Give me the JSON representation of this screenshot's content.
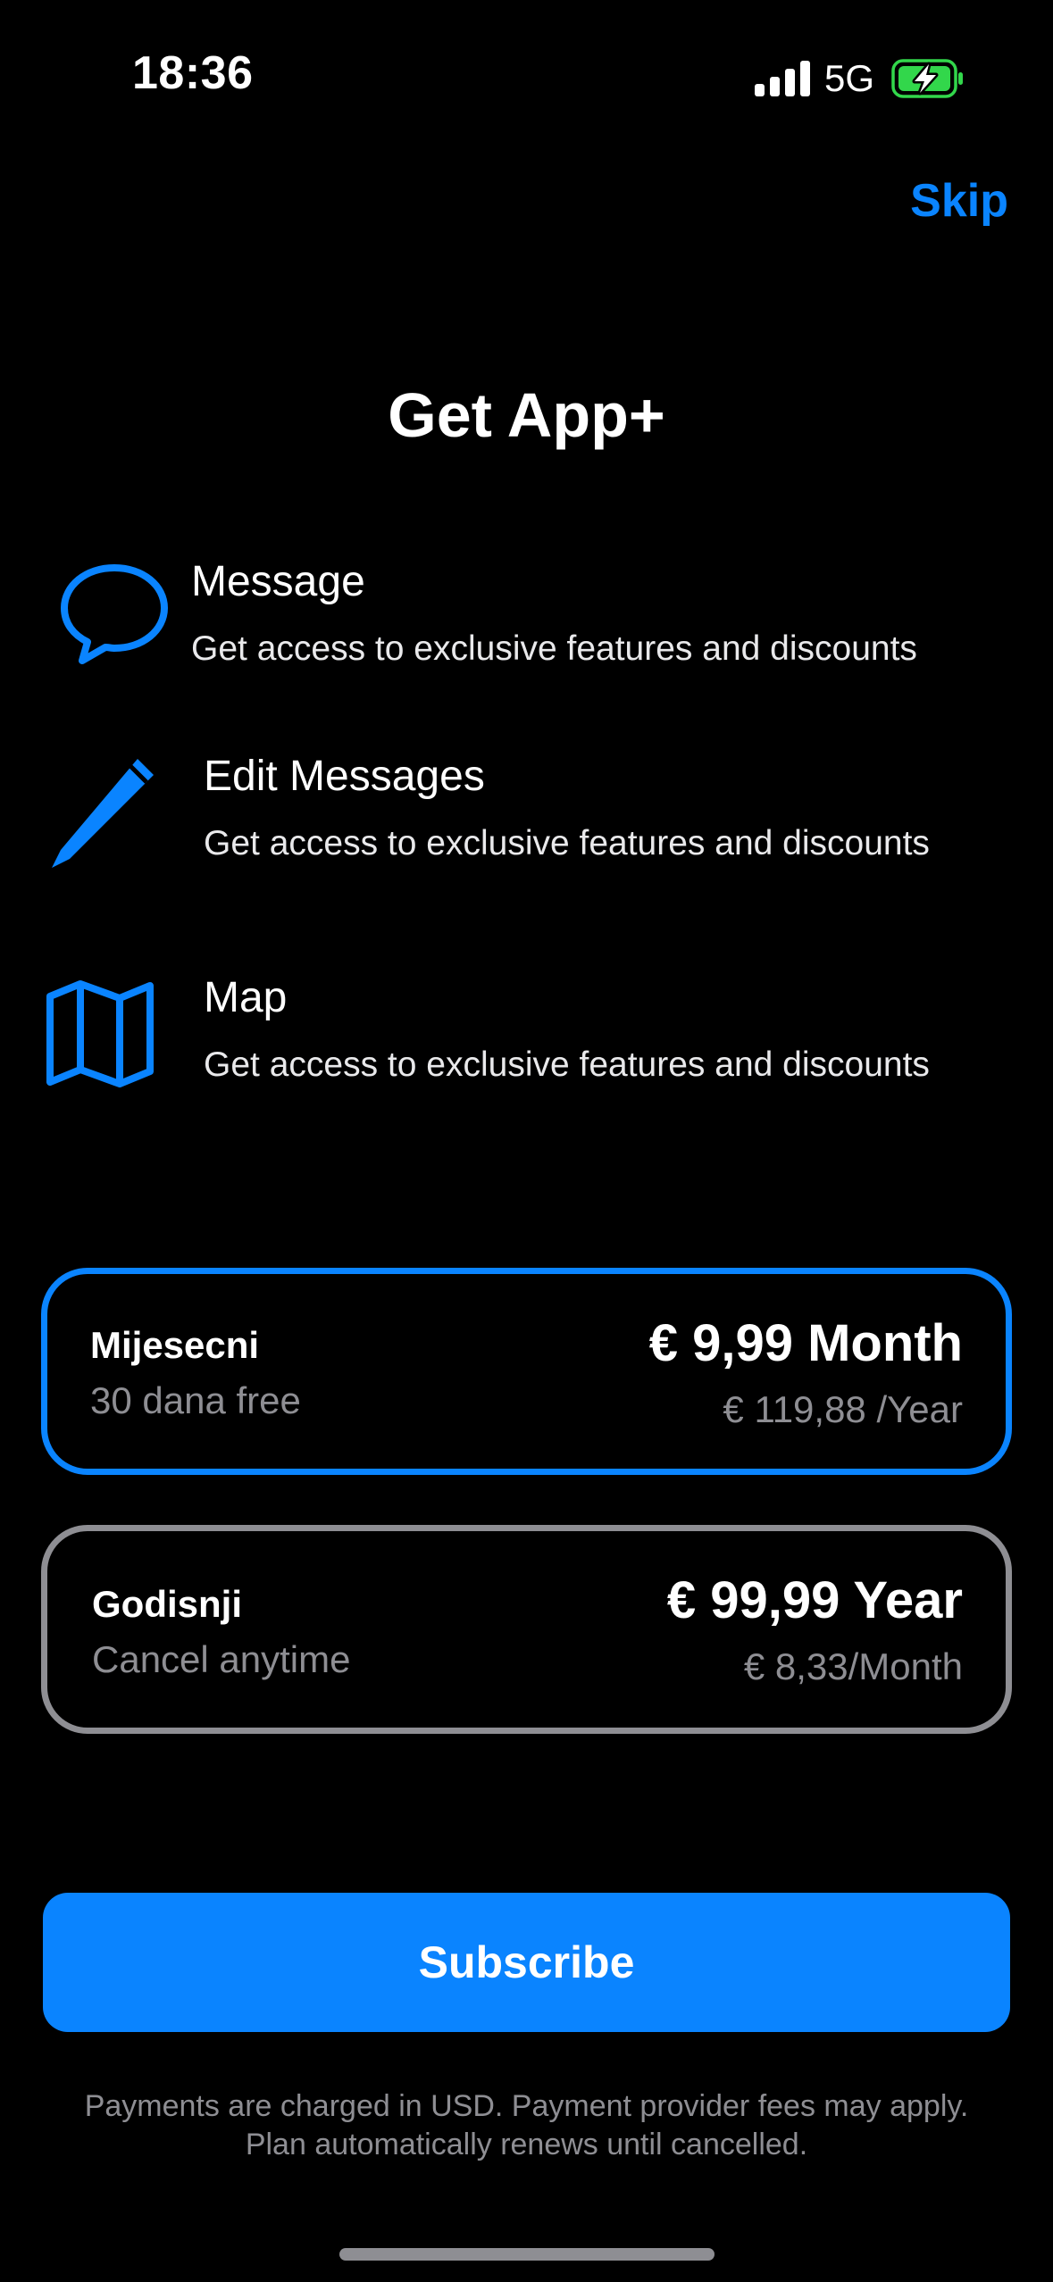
{
  "status_bar": {
    "time": "18:36",
    "network": "5G",
    "icons": [
      "signal-icon",
      "battery-charging-icon"
    ],
    "battery_color": "#32d74b"
  },
  "header": {
    "skip_label": "Skip"
  },
  "title": "Get App+",
  "features": [
    {
      "icon": "chat-bubble-icon",
      "title": "Message",
      "description": "Get access to exclusive features and discounts"
    },
    {
      "icon": "pencil-icon",
      "title": "Edit Messages",
      "description": "Get access to exclusive features and discounts"
    },
    {
      "icon": "map-icon",
      "title": "Map",
      "description": "Get access to exclusive features and discounts"
    }
  ],
  "plans": [
    {
      "name": "Mijesecni",
      "subtitle": "30 dana free",
      "price": "€ 9,99 Month",
      "alt_price": "€ 119,88 /Year",
      "selected": true
    },
    {
      "name": "Godisnji",
      "subtitle": "Cancel anytime",
      "price": "€ 99,99 Year",
      "alt_price": "€ 8,33/Month",
      "selected": false
    }
  ],
  "subscribe_label": "Subscribe",
  "disclaimer": "Payments are charged in USD. Payment provider fees may apply. Plan automatically renews until cancelled.",
  "colors": {
    "accent": "#0a84ff",
    "background": "#000000",
    "secondary_text": "#8e8e93"
  }
}
